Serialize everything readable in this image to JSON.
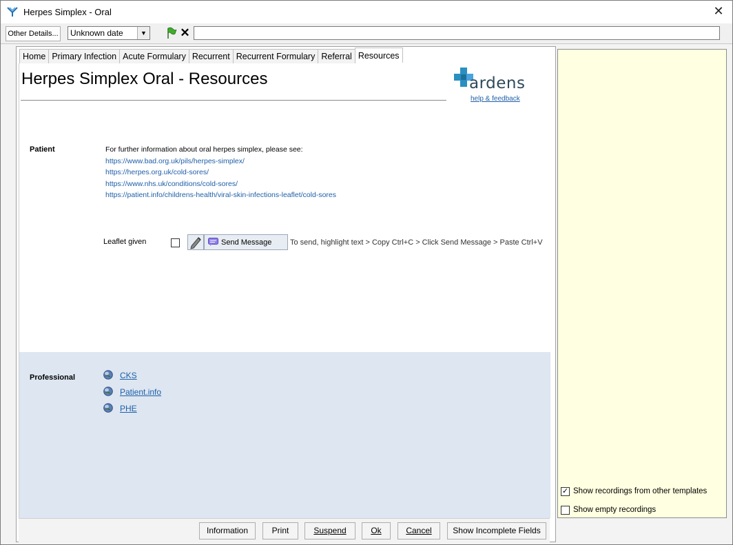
{
  "window": {
    "title": "Herpes Simplex - Oral",
    "close_glyph": "✕"
  },
  "toolbar": {
    "other_details_label": "Other Details...",
    "date_value": "Unknown date",
    "dropdown_glyph": "▼",
    "clear_glyph": "✕",
    "text_value": ""
  },
  "tabs": [
    {
      "label": "Home",
      "active": false
    },
    {
      "label": "Primary Infection",
      "active": false
    },
    {
      "label": "Acute Formulary",
      "active": false
    },
    {
      "label": "Recurrent",
      "active": false
    },
    {
      "label": "Recurrent Formulary",
      "active": false
    },
    {
      "label": "Referral",
      "active": false
    },
    {
      "label": "Resources",
      "active": true
    }
  ],
  "page": {
    "title": "Herpes Simplex Oral - Resources",
    "logo_text": "ardens",
    "help_link": "help & feedback"
  },
  "patient": {
    "label": "Patient",
    "intro": "For further information about oral herpes simplex, please see:",
    "links": [
      "https://www.bad.org.uk/pils/herpes-simplex/",
      "https://herpes.org.uk/cold-sores/",
      "https://www.nhs.uk/conditions/cold-sores/",
      "https://patient.info/childrens-health/viral-skin-infections-leaflet/cold-sores"
    ],
    "leaflet_label": "Leaflet given",
    "leaflet_checked": false,
    "send_button": "Send Message",
    "send_hint": "To send, highlight text > Copy Ctrl+C > Click Send Message > Paste Ctrl+V"
  },
  "professional": {
    "label": "Professional",
    "links": [
      "CKS",
      "Patient.info",
      "PHE"
    ]
  },
  "right_panel": {
    "show_other_templates": "Show recordings from other templates",
    "show_other_templates_checked": true,
    "show_empty": "Show empty recordings",
    "show_empty_checked": false,
    "check_glyph": "✓"
  },
  "buttons": {
    "information": "Information",
    "print": "Print",
    "suspend": "Suspend",
    "ok": "Ok",
    "cancel": "Cancel",
    "show_incomplete": "Show Incomplete Fields"
  },
  "colors": {
    "link": "#1f5fa8",
    "professional_bg": "#dde6f1",
    "right_panel_bg": "#ffffe1",
    "logo_cross": "#2a8fc1"
  }
}
